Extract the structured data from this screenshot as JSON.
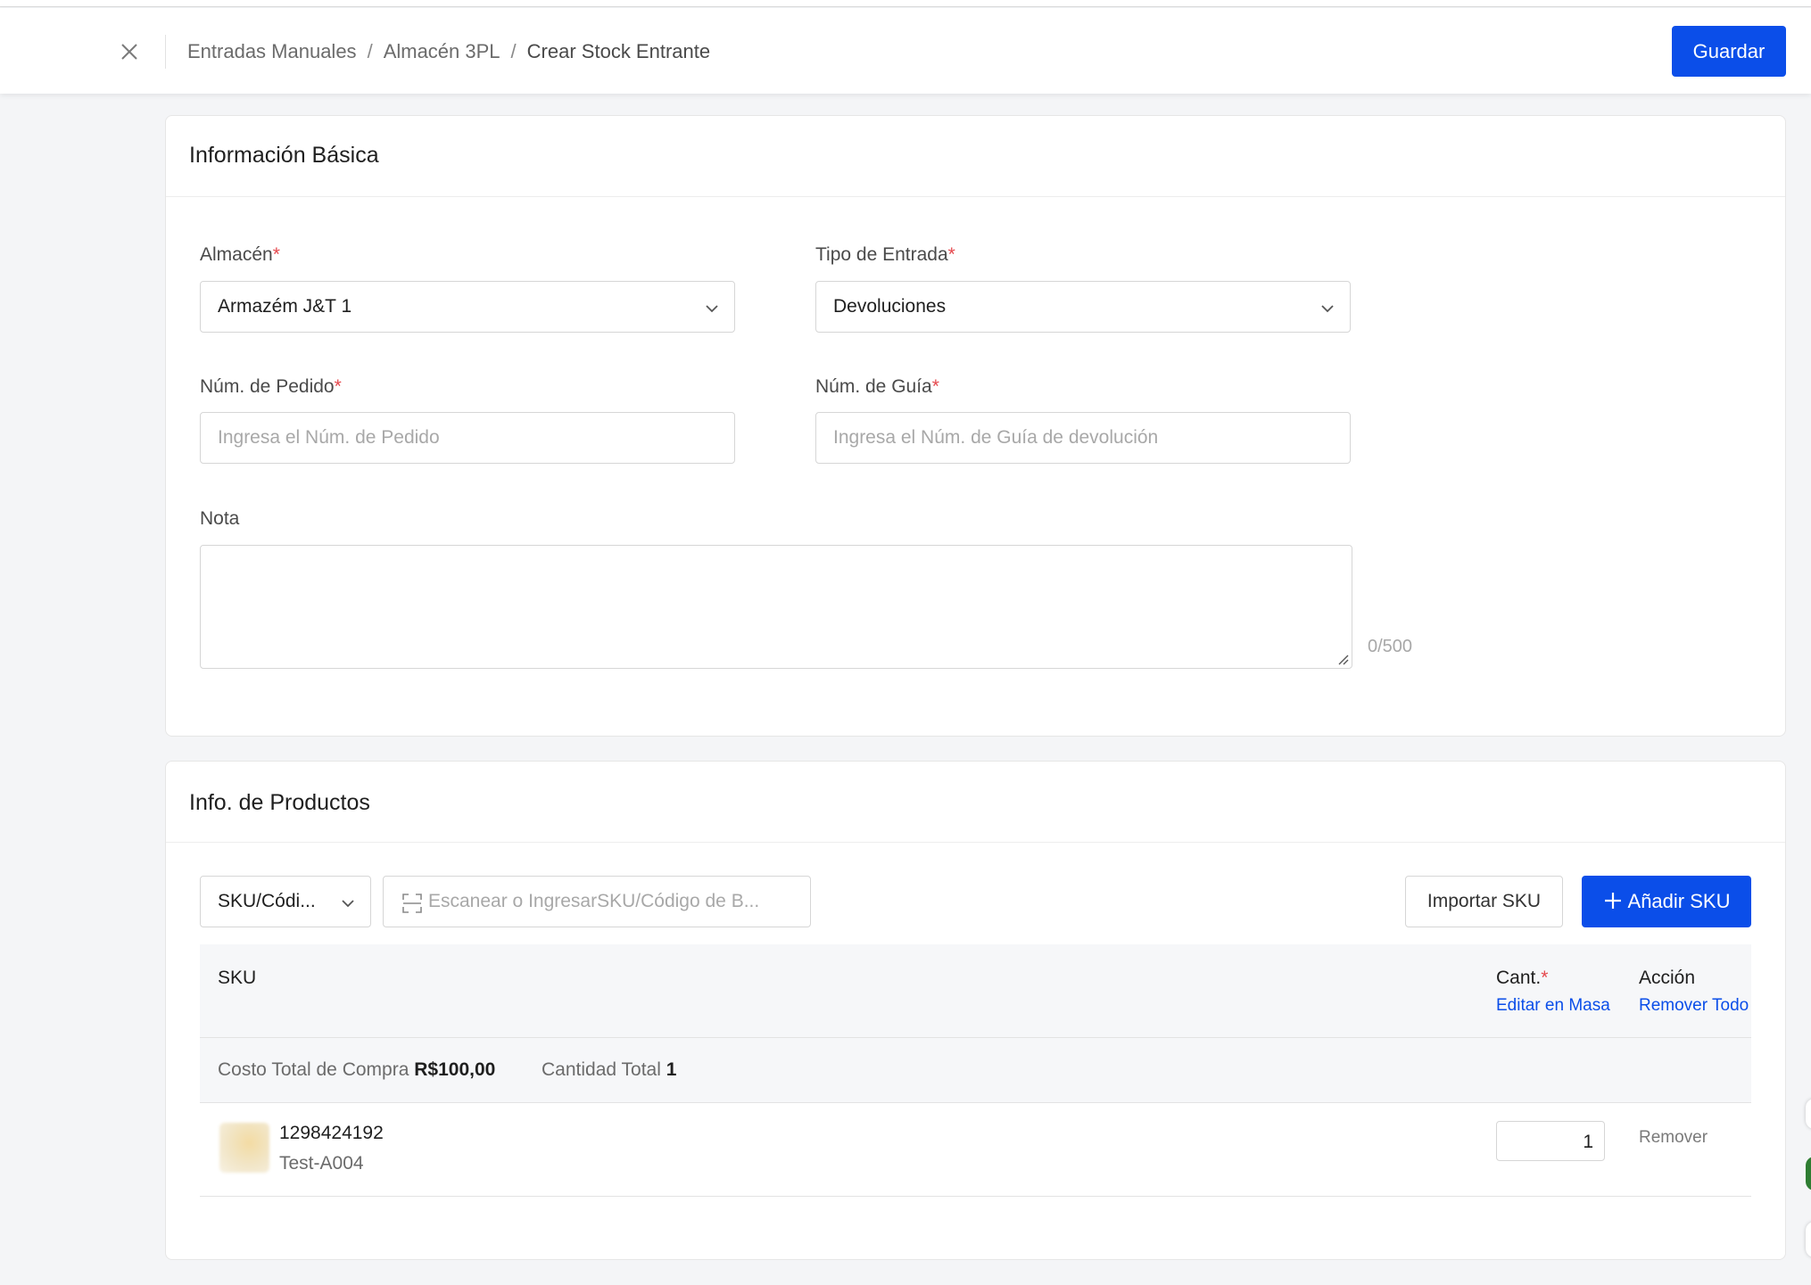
{
  "header": {
    "breadcrumb": [
      "Entradas Manuales",
      "Almacén 3PL",
      "Crear Stock Entrante"
    ],
    "separator": "/",
    "save_label": "Guardar"
  },
  "basic_info": {
    "title": "Información Básica",
    "warehouse": {
      "label": "Almacén",
      "required": "*",
      "value": "Armazém J&T 1"
    },
    "entry_type": {
      "label": "Tipo de Entrada",
      "required": "*",
      "value": "Devoluciones"
    },
    "order_no": {
      "label": "Núm. de Pedido",
      "required": "*",
      "placeholder": "Ingresa el Núm. de Pedido"
    },
    "guide_no": {
      "label": "Núm. de Guía",
      "required": "*",
      "placeholder": "Ingresa el Núm. de Guía de devolución"
    },
    "note": {
      "label": "Nota",
      "counter": "0/500"
    }
  },
  "products": {
    "title": "Info. de Productos",
    "search_type": "SKU/Códi...",
    "search_placeholder": "Escanear o IngresarSKU/Código de B...",
    "import_label": "Importar SKU",
    "add_label": "Añadir SKU",
    "table": {
      "col_sku": "SKU",
      "col_qty": "Cant.",
      "qty_required": "*",
      "bulk_edit": "Editar en Masa",
      "col_action": "Acción",
      "remove_all": "Remover Todo"
    },
    "summary": {
      "cost_label": "Costo Total de Compra",
      "cost_value": "R$100,00",
      "qty_label": "Cantidad Total",
      "qty_value": "1"
    },
    "rows": [
      {
        "sku": "1298424192",
        "name": "Test-A004",
        "qty": "1",
        "action": "Remover"
      }
    ]
  },
  "colors": {
    "accent": "#0b4ee9",
    "required": "#e5484d"
  }
}
